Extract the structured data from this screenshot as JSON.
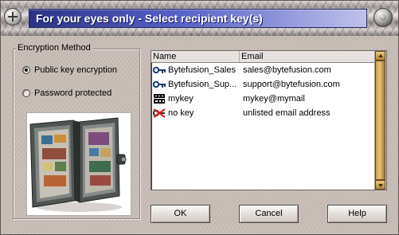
{
  "window": {
    "title": "For your eyes only - Select recipient key(s)"
  },
  "encryption": {
    "group_label": "Encryption Method",
    "options": [
      {
        "label": "Public key encryption",
        "checked": true
      },
      {
        "label": "Password protected",
        "checked": false
      }
    ]
  },
  "key_list": {
    "columns": [
      "Name",
      "Email"
    ],
    "rows": [
      {
        "name": "Bytefusion_Sales",
        "email": "sales@bytefusion.com",
        "icon": "key-icon"
      },
      {
        "name": "Bytefusion_Sup...",
        "email": "support@bytefusion.com",
        "icon": "key-icon"
      },
      {
        "name": "mykey",
        "email": "mykey@mymail",
        "icon": "openpgp-icon"
      },
      {
        "name": "no key",
        "email": "unlisted email address",
        "icon": "no-key-icon"
      }
    ]
  },
  "buttons": {
    "ok": "OK",
    "cancel": "Cancel",
    "help": "Help"
  },
  "colors": {
    "title_strip_start": "#2a3384",
    "title_strip_end": "#c0c2ea",
    "panel": "#c7bcb6",
    "scrollbar": "#e8c27b"
  }
}
